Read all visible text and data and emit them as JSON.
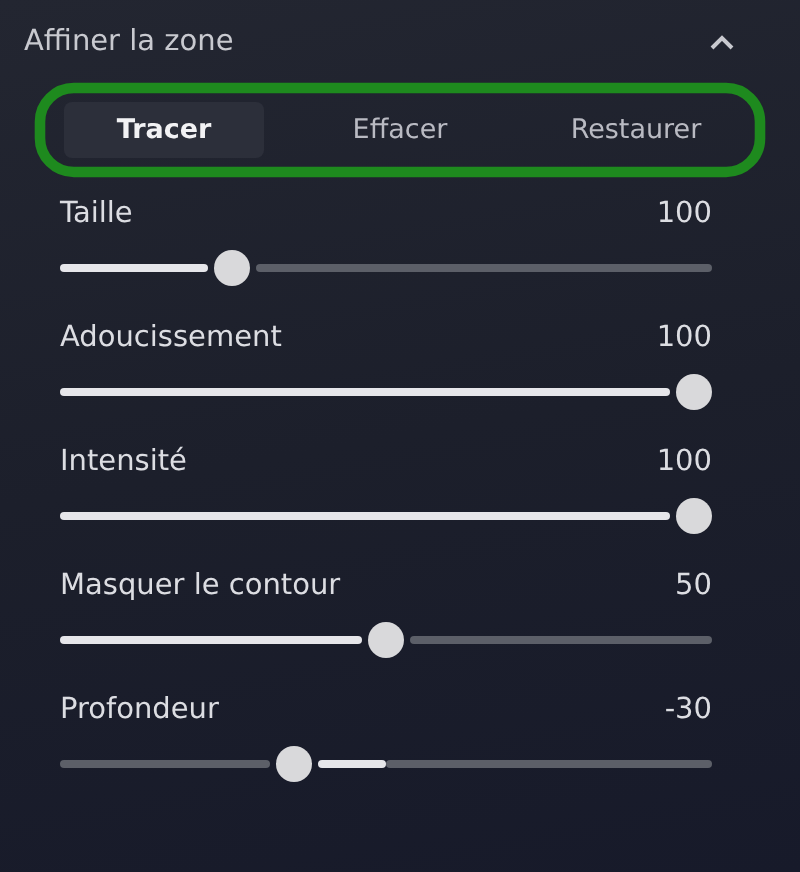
{
  "panel": {
    "title": "Affiner la zone",
    "expanded": true
  },
  "tabs": [
    {
      "label": "Tracer",
      "selected": true
    },
    {
      "label": "Effacer",
      "selected": false
    },
    {
      "label": "Restaurer",
      "selected": false
    }
  ],
  "sliders": [
    {
      "kind": "normal",
      "name": "Taille",
      "reading": "100",
      "level": 0.25
    },
    {
      "kind": "normal",
      "name": "Adoucissement",
      "reading": "100",
      "level": 1
    },
    {
      "kind": "normal",
      "name": "Intensité",
      "reading": "100",
      "level": 1
    },
    {
      "kind": "normal",
      "name": "Masquer le contour",
      "reading": "50",
      "level": 0.5
    },
    {
      "kind": "bipolar",
      "name": "Profondeur",
      "reading": "-30",
      "level": 0.35
    }
  ]
}
